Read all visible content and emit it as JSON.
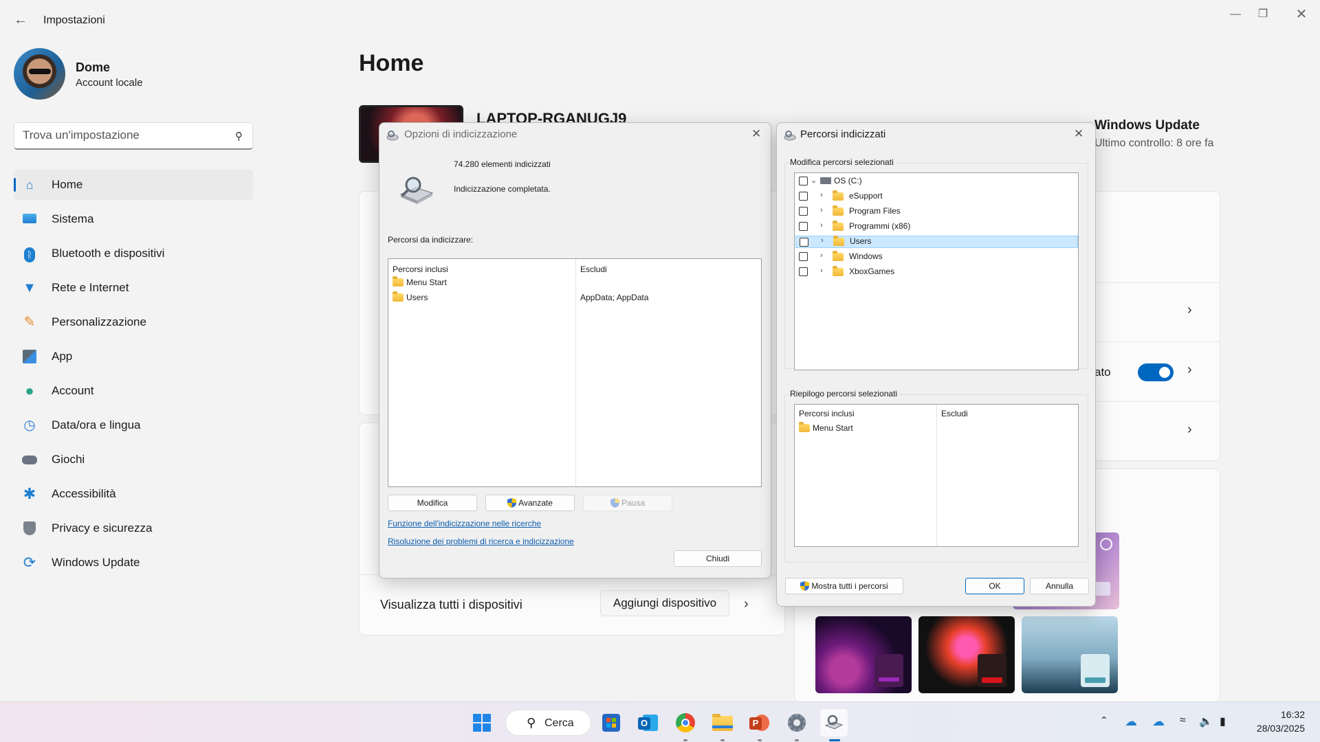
{
  "window": {
    "title": "Impostazioni",
    "back_icon": "arrow-left-icon",
    "controls": [
      "minimize",
      "restore",
      "close"
    ]
  },
  "profile": {
    "name": "Dome",
    "subtitle": "Account locale"
  },
  "search": {
    "placeholder": "Trova un'impostazione"
  },
  "sidebar": {
    "items": [
      {
        "label": "Home",
        "icon": "home-icon",
        "active": true
      },
      {
        "label": "Sistema",
        "icon": "display-icon"
      },
      {
        "label": "Bluetooth e dispositivi",
        "icon": "bluetooth-icon"
      },
      {
        "label": "Rete e Internet",
        "icon": "wifi-icon"
      },
      {
        "label": "Personalizzazione",
        "icon": "brush-icon"
      },
      {
        "label": "App",
        "icon": "apps-icon"
      },
      {
        "label": "Account",
        "icon": "person-icon"
      },
      {
        "label": "Data/ora e lingua",
        "icon": "clock-globe-icon"
      },
      {
        "label": "Giochi",
        "icon": "gamepad-icon"
      },
      {
        "label": "Accessibilità",
        "icon": "accessibility-icon"
      },
      {
        "label": "Privacy e sicurezza",
        "icon": "shield-icon"
      },
      {
        "label": "Windows Update",
        "icon": "update-icon"
      }
    ]
  },
  "main": {
    "title": "Home",
    "device_name": "LAPTOP-RGANUGJ9",
    "windows_update": {
      "title": "Windows Update",
      "subtitle": "Ultimo controllo: 8 ore fa"
    },
    "partial_text": "ato",
    "devices_row": {
      "label": "Visualizza tutti i dispositivi",
      "button": "Aggiungi dispositivo"
    }
  },
  "indexing_dialog": {
    "title": "Opzioni di indicizzazione",
    "count_text": "74.280 elementi indicizzati",
    "status_text": "Indicizzazione completata.",
    "section_label": "Percorsi da indicizzare:",
    "columns": [
      "Percorsi inclusi",
      "Escludi"
    ],
    "rows": [
      {
        "path": "Menu Start",
        "exclude": ""
      },
      {
        "path": "Users",
        "exclude": "AppData; AppData"
      }
    ],
    "buttons": {
      "modify": "Modifica",
      "advanced": "Avanzate",
      "pause": "Pausa",
      "close": "Chiudi"
    },
    "links": [
      "Funzione dell'indicizzazione nelle ricerche",
      "Risoluzione dei problemi di ricerca e indicizzazione"
    ]
  },
  "paths_dialog": {
    "title": "Percorsi indicizzati",
    "modify_group": "Modifica percorsi selezionati",
    "tree": [
      {
        "label": "OS (C:)",
        "level": 0,
        "expanded": true
      },
      {
        "label": "eSupport",
        "level": 1
      },
      {
        "label": "Program Files",
        "level": 1
      },
      {
        "label": "Programmi (x86)",
        "level": 1
      },
      {
        "label": "Users",
        "level": 1,
        "selected": true
      },
      {
        "label": "Windows",
        "level": 1
      },
      {
        "label": "XboxGames",
        "level": 1
      }
    ],
    "summary_group": "Riepilogo percorsi selezionati",
    "columns": [
      "Percorsi inclusi",
      "Escludi"
    ],
    "rows": [
      {
        "path": "Menu Start",
        "exclude": ""
      }
    ],
    "buttons": {
      "show_all": "Mostra tutti i percorsi",
      "ok": "OK",
      "cancel": "Annulla"
    }
  },
  "taskbar": {
    "search_label": "Cerca",
    "apps": [
      "start-icon",
      "store-icon",
      "outlook-icon",
      "chrome-icon",
      "file-explorer-icon",
      "powerpoint-icon",
      "settings-icon",
      "indexing-icon"
    ],
    "time": "16:32",
    "date": "28/03/2025"
  },
  "colors": {
    "accent": "#0067c0",
    "link": "#0b5cad",
    "selection": "#cce8ff"
  }
}
